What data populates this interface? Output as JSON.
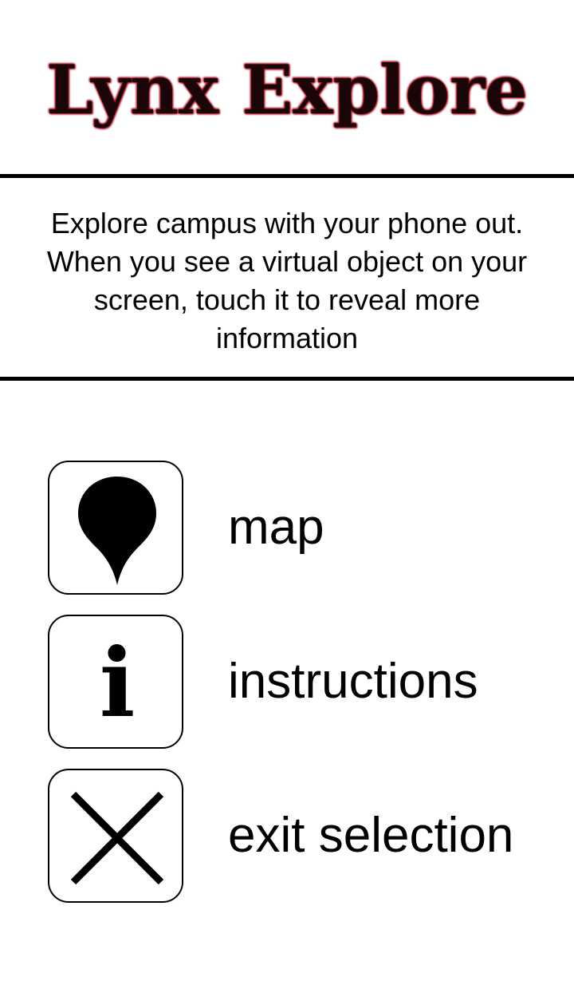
{
  "header": {
    "title": "Lynx Explore",
    "title_color": "#1a0508",
    "title_glow_color": "#b01020"
  },
  "intro": {
    "text": "Explore campus with your phone out. When you see a virtual object on your screen, touch it to reveal more information"
  },
  "menu": {
    "items": [
      {
        "label": "map",
        "icon": "map-pin-icon"
      },
      {
        "label": "instructions",
        "icon": "info-icon",
        "glyph": "i"
      },
      {
        "label": "exit selection",
        "icon": "close-icon"
      }
    ]
  }
}
